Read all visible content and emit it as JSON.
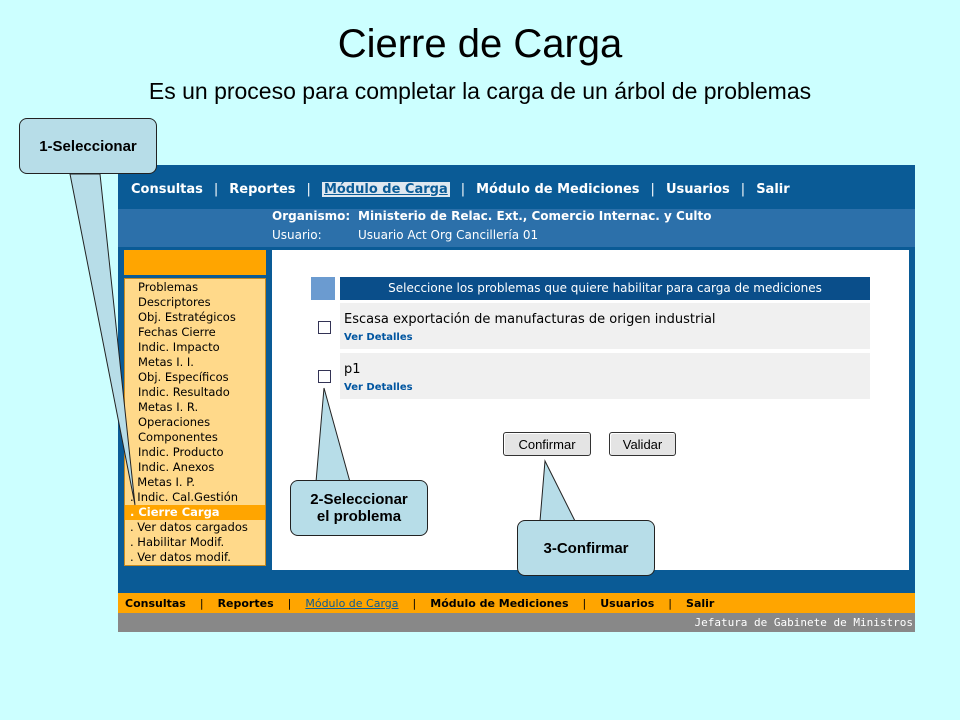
{
  "slide": {
    "title": "Cierre de Carga",
    "subtitle": "Es un proceso para completar la carga de un árbol de problemas"
  },
  "app": {
    "top_nav": [
      "Consultas",
      "Reportes",
      "Módulo de Carga",
      "Módulo de Mediciones",
      "Usuarios",
      "Salir"
    ],
    "top_nav_active": "Módulo de Carga",
    "header": {
      "org_label": "Organismo:",
      "org_value": "Ministerio de Relac. Ext., Comercio Internac. y Culto",
      "user_label": "Usuario:",
      "user_value": "Usuario Act Org Cancillería 01"
    },
    "left_menu": [
      "Problemas",
      "Descriptores",
      "Obj. Estratégicos",
      "Fechas Cierre",
      "Indic. Impacto",
      "Metas I. I.",
      "Obj. Específicos",
      "Indic. Resultado",
      "Metas I. R.",
      "Operaciones",
      "Componentes",
      "Indic. Producto",
      "Indic. Anexos",
      ". Metas I. P.",
      ". Indic. Cal.Gestión",
      ". Cierre Carga",
      ". Ver datos cargados",
      ". Habilitar Modif.",
      ". Ver datos modif."
    ],
    "left_menu_current": ". Cierre Carga",
    "panel_header": "Seleccione los problemas que quiere habilitar para carga de mediciones",
    "problems": [
      {
        "name": "Escasa exportación de manufacturas de origen industrial",
        "link": "Ver Detalles",
        "checked": false
      },
      {
        "name": "p1",
        "link": "Ver Detalles",
        "checked": false
      }
    ],
    "buttons": {
      "confirm": "Confirmar",
      "validate": "Validar"
    },
    "bottom_nav": [
      "Consultas",
      "Reportes",
      "Módulo de Carga",
      "Módulo de Mediciones",
      "Usuarios",
      "Salir"
    ],
    "footer": "Jefatura de Gabinete de Ministros",
    "colors": {
      "nav_blue": "#0a5b96",
      "orange": "#ffa500",
      "menu_bg": "#ffd98a"
    }
  },
  "callouts": {
    "step1": "1-Seleccionar",
    "step2_line1": "2-Seleccionar",
    "step2_line2": "el problema",
    "step3": "3-Confirmar"
  }
}
